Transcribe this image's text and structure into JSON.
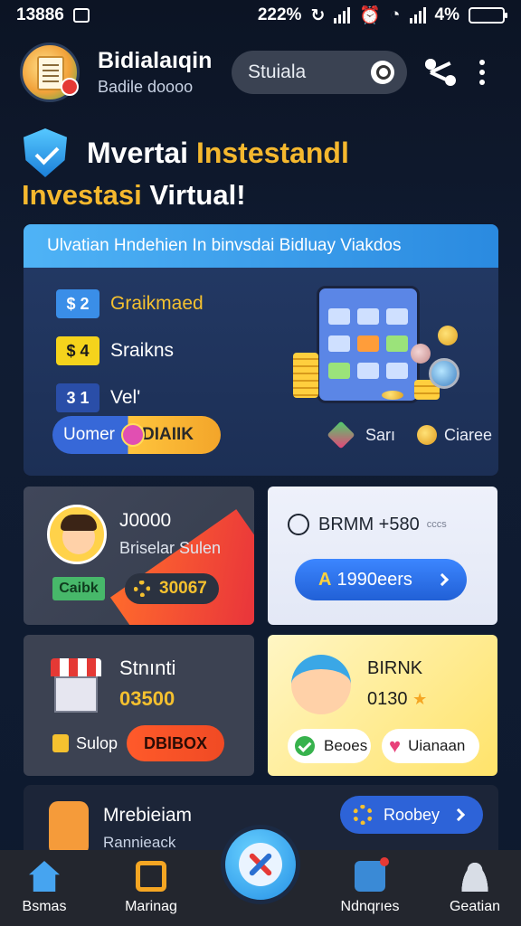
{
  "status_bar": {
    "time": "13886",
    "battery_pct": "222%",
    "battery_right": "4%"
  },
  "header": {
    "user_name": "Bidialaıqin",
    "user_sub": "Badile doooo",
    "search_text": "Stuiala"
  },
  "title": {
    "line1_white": "Mvertai ",
    "line1_gold": "Instestandl",
    "line2_gold": "Investasi ",
    "line2_white": "Virtual!"
  },
  "hero": {
    "banner": "Ulvatian Hndehien In binvsdai Bidluay Viakdos",
    "stats": [
      {
        "badge": "$ 2",
        "label": "Graikmaed",
        "badge_bg": "#3a8ee8",
        "badge_color": "#ffffff"
      },
      {
        "badge": "$ 4",
        "label": "Sraikns",
        "badge_bg": "#f5d31c",
        "badge_color": "#1b1b1b"
      },
      {
        "badge": "3 1",
        "label": "Vel'",
        "badge_bg": "#2a4ea8",
        "badge_color": "#ffffff"
      }
    ],
    "button_left": "Uomer",
    "button_right": "DIAIIK",
    "footer_left": "Sarı",
    "footer_right": "Ciaree"
  },
  "card_a": {
    "title": "J0000",
    "subtitle": "Briselar Sulen",
    "pill": "Caibk",
    "amount": "30067"
  },
  "card_b": {
    "rate": "BRMM +580",
    "rate_small": "cccs",
    "button_prefix": "A",
    "button_text": "1990eers"
  },
  "card_c": {
    "title": "Stnınti",
    "value": "03500",
    "small_label": "Sulop",
    "button": "DBlBOX"
  },
  "card_d": {
    "title": "BIRNK",
    "value": "0130",
    "chip_left": "Beoes",
    "chip_right": "Uianaan"
  },
  "card_e": {
    "title": "Mrebieiam",
    "subtitle": "Rannieack",
    "button": "Roobey"
  },
  "bottom_nav": [
    {
      "label": "Bsmas"
    },
    {
      "label": "Marinag"
    },
    {
      "label": "Ndnqrıes"
    },
    {
      "label": "Geatian"
    }
  ],
  "colors": {
    "accent_gold": "#f5b82e",
    "accent_blue": "#2a8ae0",
    "background": "#0c1424"
  }
}
